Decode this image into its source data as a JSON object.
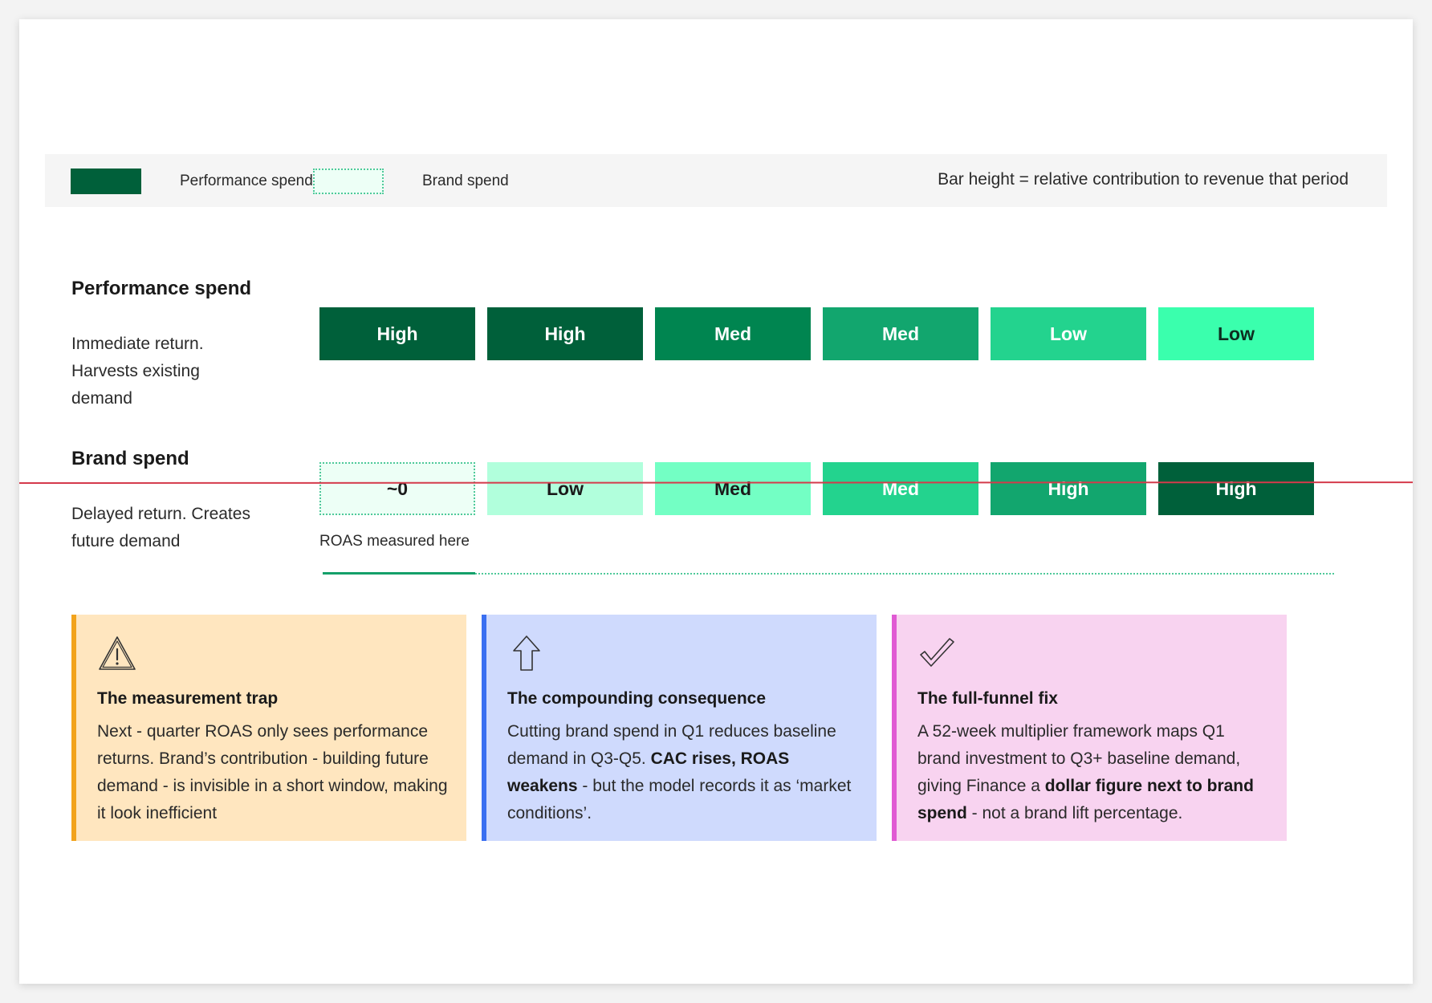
{
  "legend": {
    "performance_label": "Performance spend",
    "brand_label": "Brand spend",
    "note": "Bar height = relative contribution to revenue that period",
    "performance_color": "#00603a",
    "brand_color": "#edfff6"
  },
  "rows": {
    "performance": {
      "title": "Performance spend",
      "desc": "Immediate return. Harvests existing demand",
      "cells": [
        {
          "label": "High",
          "bg": "#00603a",
          "fg": "#ffffff"
        },
        {
          "label": "High",
          "bg": "#00603a",
          "fg": "#ffffff"
        },
        {
          "label": "Med",
          "bg": "#008550",
          "fg": "#ffffff"
        },
        {
          "label": "Med",
          "bg": "#12a66e",
          "fg": "#ffffff"
        },
        {
          "label": "Low",
          "bg": "#23d38e",
          "fg": "#ffffff"
        },
        {
          "label": "Low",
          "bg": "#3affad",
          "fg": "#0d2e1f"
        }
      ]
    },
    "brand": {
      "title": "Brand spend",
      "desc": "Delayed return. Creates future demand",
      "cells": [
        {
          "label": "~0",
          "bg": "#edfff6",
          "fg": "#1a1a1a",
          "dotted": true
        },
        {
          "label": "Low",
          "bg": "#b1ffdc",
          "fg": "#1a1a1a"
        },
        {
          "label": "Med",
          "bg": "#73ffc4",
          "fg": "#1a1a1a"
        },
        {
          "label": "Med",
          "bg": "#23d38e",
          "fg": "#ffffff"
        },
        {
          "label": "High",
          "bg": "#12a66e",
          "fg": "#ffffff"
        },
        {
          "label": "High",
          "bg": "#00603a",
          "fg": "#ffffff"
        }
      ]
    }
  },
  "roas_note": "ROAS measured here",
  "callouts": [
    {
      "icon": "warning-icon",
      "title": "The measurement trap",
      "body": "Next - quarter ROAS only sees performance returns. Brand’s contribution - building future demand - is invisible in a short window, making it look inefficient"
    },
    {
      "icon": "arrow-up-icon",
      "title": "The compounding consequence",
      "body_parts": [
        {
          "text": "Cutting brand spend in Q1 reduces baseline demand in Q3-Q5. ",
          "bold": false
        },
        {
          "text": "CAC rises, ROAS weakens",
          "bold": true
        },
        {
          "text": " - but the model records it as ‘market conditions’.",
          "bold": false
        }
      ]
    },
    {
      "icon": "checkmark-icon",
      "title": "The full-funnel fix",
      "body_parts": [
        {
          "text": "A 52-week multiplier framework maps Q1 brand investment to Q3+ baseline demand, giving Finance a ",
          "bold": false
        },
        {
          "text": "dollar figure next to brand spend",
          "bold": true
        },
        {
          "text": " - not a brand lift percentage.",
          "bold": false
        }
      ]
    }
  ]
}
